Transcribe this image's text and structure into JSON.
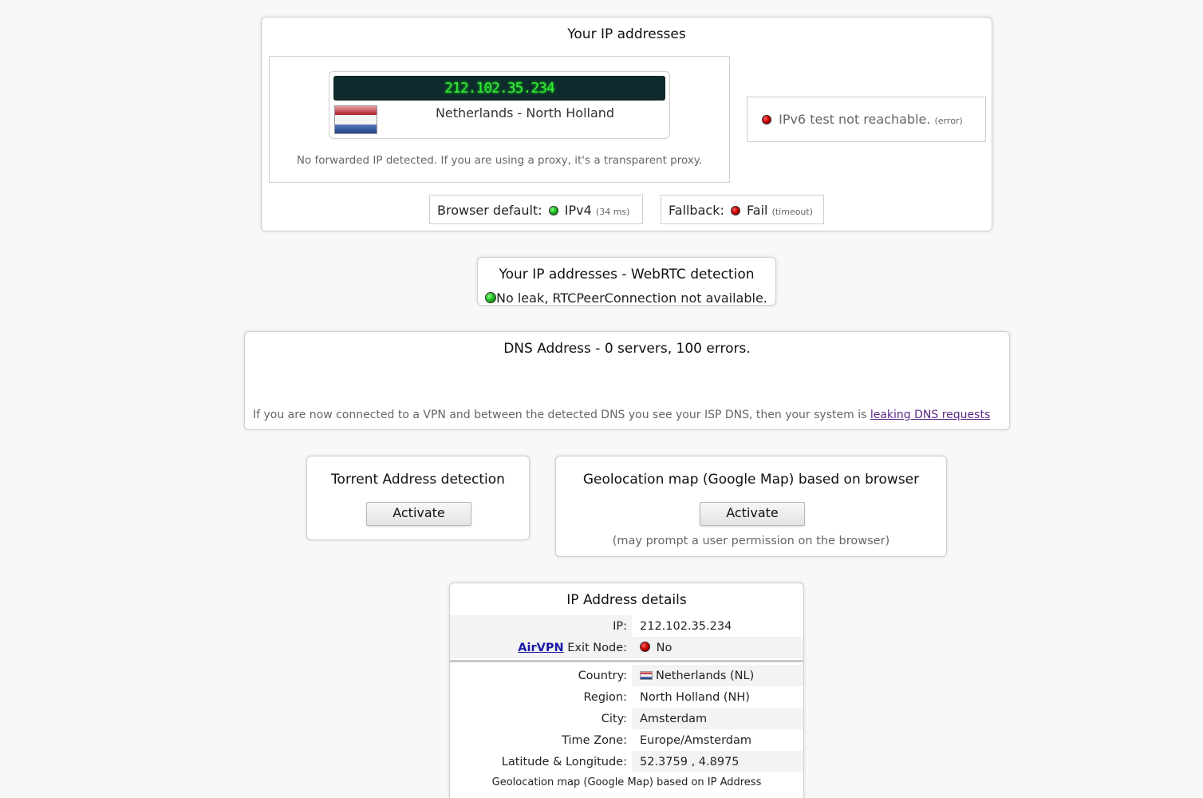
{
  "ip_section": {
    "title": "Your IP addresses",
    "ip": "212.102.35.234",
    "location": "Netherlands - North Holland",
    "forwarded_note": "No forwarded IP detected. If you are using a proxy, it's a transparent proxy.",
    "ipv6_text": "IPv6 test not reachable.",
    "ipv6_note": "(error)",
    "browser_default_label": "Browser default:",
    "browser_default_value": "IPv4",
    "browser_default_time": "(34 ms)",
    "fallback_label": "Fallback:",
    "fallback_value": "Fail",
    "fallback_note": "(timeout)"
  },
  "webrtc": {
    "title": "Your IP addresses - WebRTC detection",
    "status": "No leak, RTCPeerConnection not available."
  },
  "dns": {
    "title": "DNS Address - 0 servers, 100 errors.",
    "note": "If you are now connected to a VPN and between the detected DNS you see your ISP DNS, then your system is",
    "link": "leaking DNS requests"
  },
  "torrent": {
    "title": "Torrent Address detection",
    "button": "Activate"
  },
  "geolocation": {
    "title": "Geolocation map (Google Map) based on browser",
    "button": "Activate",
    "note": "(may prompt a user permission on the browser)"
  },
  "details": {
    "title": "IP Address details",
    "ip_label": "IP:",
    "ip_value": "212.102.35.234",
    "airvpn_link": "AirVPN",
    "exit_label": "Exit Node:",
    "exit_value": "No",
    "rows": [
      {
        "label": "Country:",
        "value": "Netherlands (NL)"
      },
      {
        "label": "Region:",
        "value": "North Holland (NH)"
      },
      {
        "label": "City:",
        "value": "Amsterdam"
      },
      {
        "label": "Time Zone:",
        "value": "Europe/Amsterdam"
      },
      {
        "label": "Latitude & Longitude:",
        "value": "52.3759 , 4.8975"
      }
    ],
    "map_caption": "Geolocation map (Google Map) based on IP Address"
  },
  "colors": {
    "ip_display_bg": "#0f2a2c",
    "ip_display_text": "#38e838",
    "status_ok": "#22bb22",
    "status_fail": "#cc0000"
  }
}
